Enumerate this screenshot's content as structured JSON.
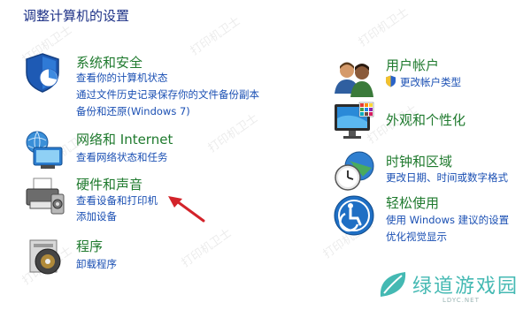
{
  "page": {
    "title": "调整计算机的设置"
  },
  "categories": {
    "system_security": {
      "title": "系统和安全",
      "links": [
        "查看你的计算机状态",
        "通过文件历史记录保存你的文件备份副本",
        "备份和还原(Windows 7)"
      ],
      "icon": "shield-icon"
    },
    "network": {
      "title": "网络和 Internet",
      "links": [
        "查看网络状态和任务"
      ],
      "icon": "network-icon"
    },
    "hardware": {
      "title": "硬件和声音",
      "links": [
        "查看设备和打印机",
        "添加设备"
      ],
      "icon": "printer-icon"
    },
    "programs": {
      "title": "程序",
      "links": [
        "卸载程序"
      ],
      "icon": "programs-icon"
    },
    "user_accounts": {
      "title": "用户帐户",
      "links": [
        "更改帐户类型"
      ],
      "icon": "users-icon"
    },
    "appearance": {
      "title": "外观和个性化",
      "links": [],
      "icon": "monitor-icon"
    },
    "clock_region": {
      "title": "时钟和区域",
      "links": [
        "更改日期、时间或数字格式"
      ],
      "icon": "clock-globe-icon"
    },
    "ease_access": {
      "title": "轻松使用",
      "links": [
        "使用 Windows 建议的设置",
        "优化视觉显示"
      ],
      "icon": "ease-of-access-icon"
    }
  },
  "watermark": {
    "text": "打印机卫士"
  },
  "logo": {
    "text": "绿道游戏园",
    "sub": "LDYC.NET"
  },
  "colors": {
    "title": "#1e3287",
    "category": "#1f7a2e",
    "link": "#1a4fb3",
    "arrow": "#d3232a"
  }
}
